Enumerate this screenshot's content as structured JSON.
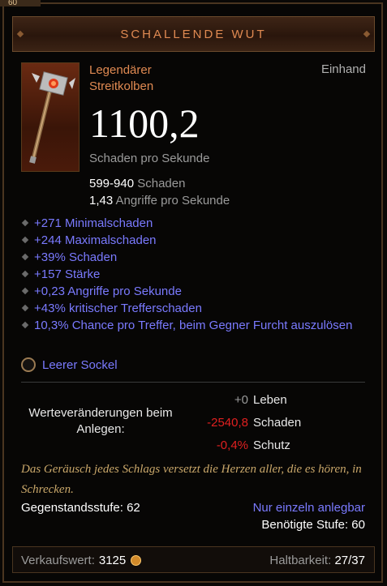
{
  "badge": "60",
  "title": "SCHALLENDE WUT",
  "item_icon": "mace-icon",
  "item_type": {
    "rarity": "Legendärer",
    "kind": "Streitkolben",
    "slot": "Einhand"
  },
  "dps": {
    "value": "1100,2",
    "label": "Schaden pro Sekunde"
  },
  "stats": [
    {
      "value": "599-940",
      "label": "Schaden"
    },
    {
      "value": "1,43",
      "label": "Angriffe pro Sekunde"
    }
  ],
  "affixes": [
    "+271 Minimalschaden",
    "+244 Maximalschaden",
    "+39% Schaden",
    "+157 Stärke",
    "+0,23 Angriffe pro Sekunde",
    "+43% kritischer Trefferschaden",
    "10,3% Chance pro Treffer, beim Gegner Furcht auszulösen"
  ],
  "socket": {
    "label": "Leerer Sockel"
  },
  "compare": {
    "label": "Werteveränderungen beim Anlegen:",
    "rows": [
      {
        "value": "+0",
        "name": "Leben",
        "tone": "zero"
      },
      {
        "value": "-2540,8",
        "name": "Schaden",
        "tone": "neg"
      },
      {
        "value": "-0,4%",
        "name": "Schutz",
        "tone": "neg"
      }
    ]
  },
  "flavor": "Das Geräusch jedes Schlags versetzt die Herzen aller, die es hören, in Schrecken.",
  "item_level": "Gegenstandsstufe: 62",
  "unique_equipped": "Nur einzeln anlegbar",
  "required_level": "Benötigte Stufe: 60",
  "sell_value": {
    "label": "Verkaufswert:",
    "value": "3125"
  },
  "durability": {
    "label": "Haltbarkeit:",
    "value": "27/37"
  },
  "colors": {
    "title": "#e08a52",
    "magic": "#7a7aff",
    "negative": "#e02020",
    "flavor": "#c9a76a"
  }
}
